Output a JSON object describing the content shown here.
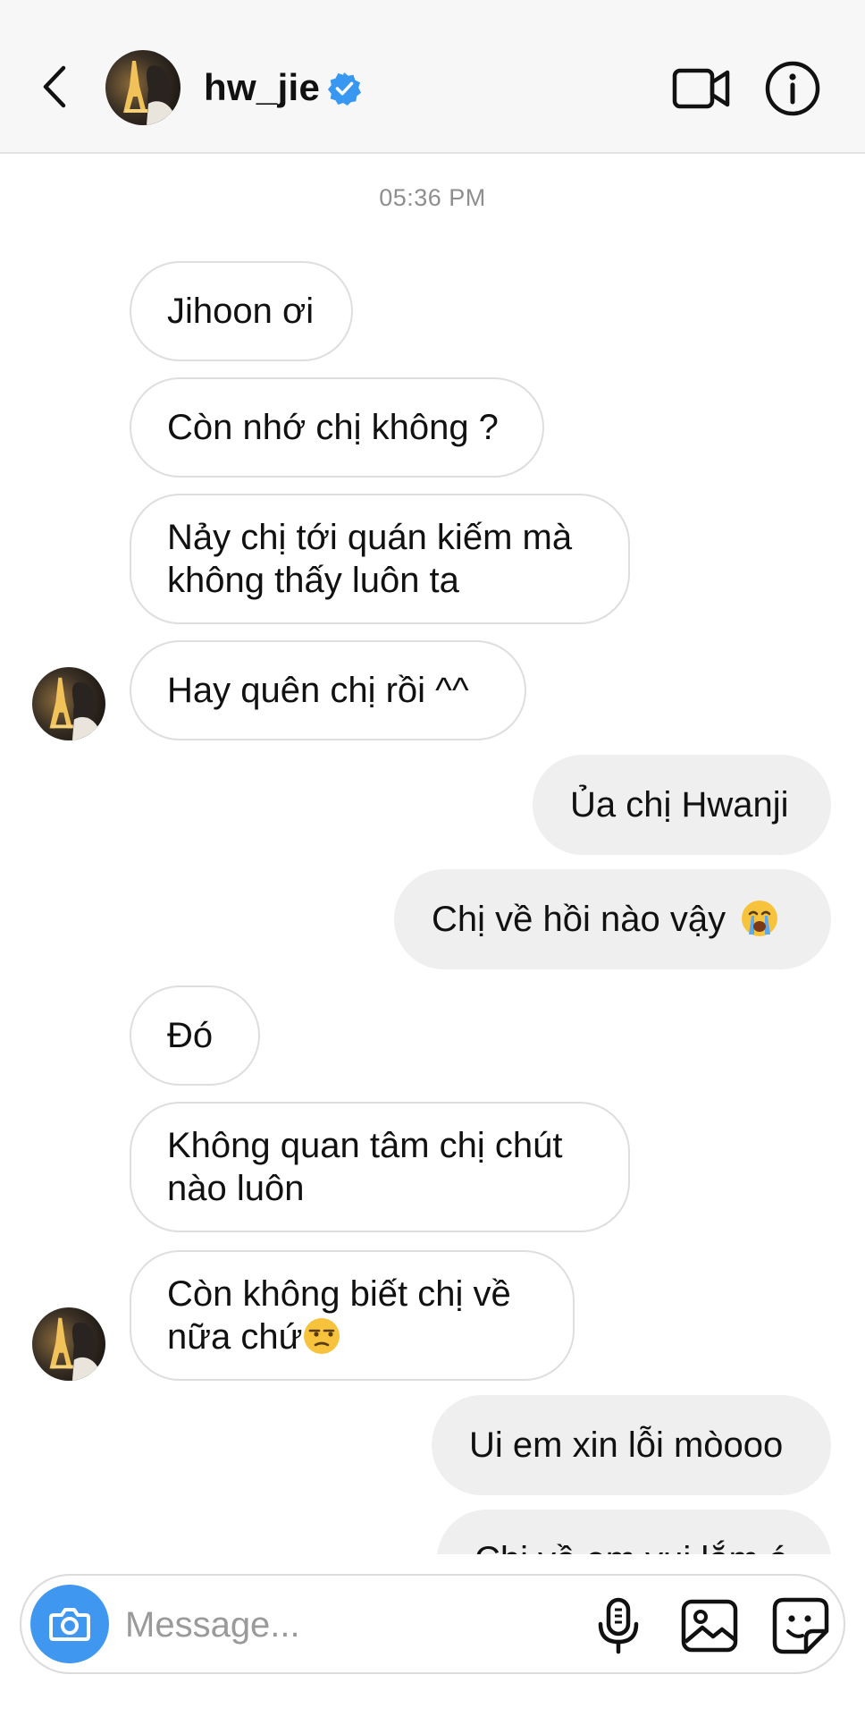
{
  "header": {
    "back_icon": "chevron-left-icon",
    "username": "hw_jie",
    "verified_icon": "verified-badge-icon",
    "verified_color": "#3897f0",
    "video_icon": "video-camera-icon",
    "info_icon": "info-icon"
  },
  "conversation": {
    "timestamp": "05:36 PM",
    "messages": [
      {
        "sender": "them",
        "lines": [
          "Jihoon ơi"
        ]
      },
      {
        "sender": "them",
        "lines": [
          "Còn nhớ chị không ?"
        ]
      },
      {
        "sender": "them",
        "lines": [
          "Nảy chị tới quán kiếm mà",
          "không thấy luôn ta"
        ]
      },
      {
        "sender": "them",
        "lines": [
          "Hay quên chị rồi ^^"
        ]
      },
      {
        "sender": "me",
        "lines": [
          "Ủa chị Hwanji"
        ]
      },
      {
        "sender": "me",
        "lines": [
          "Chị về hồi nào vậy"
        ],
        "emoji": "crying-face-icon"
      },
      {
        "sender": "them",
        "lines": [
          "Đó"
        ]
      },
      {
        "sender": "them",
        "lines": [
          "Không quan tâm chị chút",
          "nào luôn"
        ]
      },
      {
        "sender": "them",
        "lines": [
          "Còn không biết chị về",
          "nữa chứ"
        ],
        "emoji": "unamused-face-icon"
      },
      {
        "sender": "me",
        "lines": [
          "Ui em xin lỗi mòooo"
        ]
      },
      {
        "sender": "me",
        "lines": [
          "Chị về em vui lắm á"
        ],
        "partially_visible": true
      }
    ]
  },
  "composer": {
    "camera_icon": "camera-icon",
    "camera_color": "#3f97f0",
    "placeholder": "Message...",
    "value": "",
    "mic_icon": "microphone-icon",
    "image_icon": "image-icon",
    "sticker_icon": "sticker-icon"
  }
}
